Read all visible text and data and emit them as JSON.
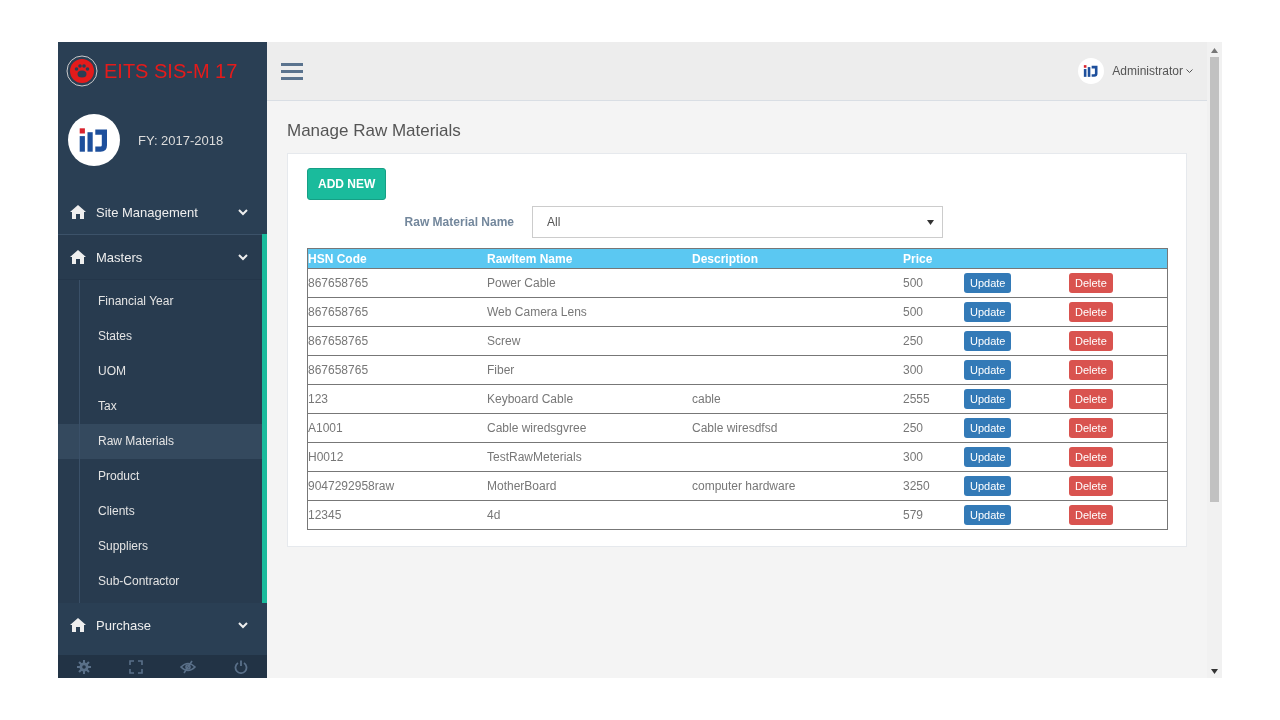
{
  "sidebar": {
    "brand": "EITS SIS-M 17",
    "fiscal_year": "FY: 2017-2018",
    "nav": [
      {
        "label": "Site Management",
        "expanded": false
      },
      {
        "label": "Masters",
        "expanded": true,
        "children": [
          {
            "label": "Financial Year",
            "selected": false
          },
          {
            "label": "States",
            "selected": false
          },
          {
            "label": "UOM",
            "selected": false
          },
          {
            "label": "Tax",
            "selected": false
          },
          {
            "label": "Raw Materials",
            "selected": true
          },
          {
            "label": "Product",
            "selected": false
          },
          {
            "label": "Clients",
            "selected": false
          },
          {
            "label": "Suppliers",
            "selected": false
          },
          {
            "label": "Sub-Contractor",
            "selected": false
          }
        ]
      },
      {
        "label": "Purchase",
        "expanded": false
      }
    ]
  },
  "topbar": {
    "user": "Administrator"
  },
  "page": {
    "title": "Manage Raw Materials",
    "add_button": "ADD NEW",
    "filter": {
      "label": "Raw Material Name",
      "value": "All"
    },
    "table": {
      "columns": [
        "HSN Code",
        "RawItem Name",
        "Description",
        "Price"
      ],
      "rows": [
        {
          "hsn": "867658765",
          "name": "Power Cable",
          "description": "",
          "price": "500",
          "actions": [
            {
              "label": "Update",
              "kind": "update"
            },
            {
              "label": "Delete",
              "kind": "delete"
            }
          ]
        },
        {
          "hsn": "867658765",
          "name": "Web Camera Lens",
          "description": "",
          "price": "500",
          "actions": [
            {
              "label": "Update",
              "kind": "update"
            },
            {
              "label": "Delete",
              "kind": "delete"
            }
          ]
        },
        {
          "hsn": "867658765",
          "name": "Screw",
          "description": "",
          "price": "250",
          "actions": [
            {
              "label": "Update",
              "kind": "update"
            },
            {
              "label": "Delete",
              "kind": "delete"
            }
          ]
        },
        {
          "hsn": "867658765",
          "name": "Fiber",
          "description": "",
          "price": "300",
          "actions": [
            {
              "label": "Update",
              "kind": "update"
            },
            {
              "label": "Delete",
              "kind": "delete"
            }
          ]
        },
        {
          "hsn": "123",
          "name": "Keyboard Cable",
          "description": "cable",
          "price": "2555",
          "actions": [
            {
              "label": "Update",
              "kind": "update"
            },
            {
              "label": "Delete",
              "kind": "delete"
            }
          ]
        },
        {
          "hsn": "A1001",
          "name": "Cable wiredsgvree",
          "description": "Cable wiresdfsd",
          "price": "250",
          "actions": [
            {
              "label": "Update",
              "kind": "update"
            },
            {
              "label": "Delete",
              "kind": "delete"
            }
          ]
        },
        {
          "hsn": "H0012",
          "name": "TestRawMeterials",
          "description": "",
          "price": "300",
          "actions": [
            {
              "label": "Update",
              "kind": "update"
            },
            {
              "label": "Delete",
              "kind": "delete"
            }
          ]
        },
        {
          "hsn": "9047292958raw",
          "name": "MotherBoard",
          "description": "computer hardware",
          "price": "3250",
          "actions": [
            {
              "label": "Update",
              "kind": "update"
            },
            {
              "label": "Delete",
              "kind": "delete"
            }
          ]
        },
        {
          "hsn": "12345",
          "name": "4d",
          "description": "",
          "price": "579",
          "actions": [
            {
              "label": "Update",
              "kind": "update"
            },
            {
              "label": "Delete",
              "kind": "delete"
            }
          ]
        }
      ]
    }
  }
}
